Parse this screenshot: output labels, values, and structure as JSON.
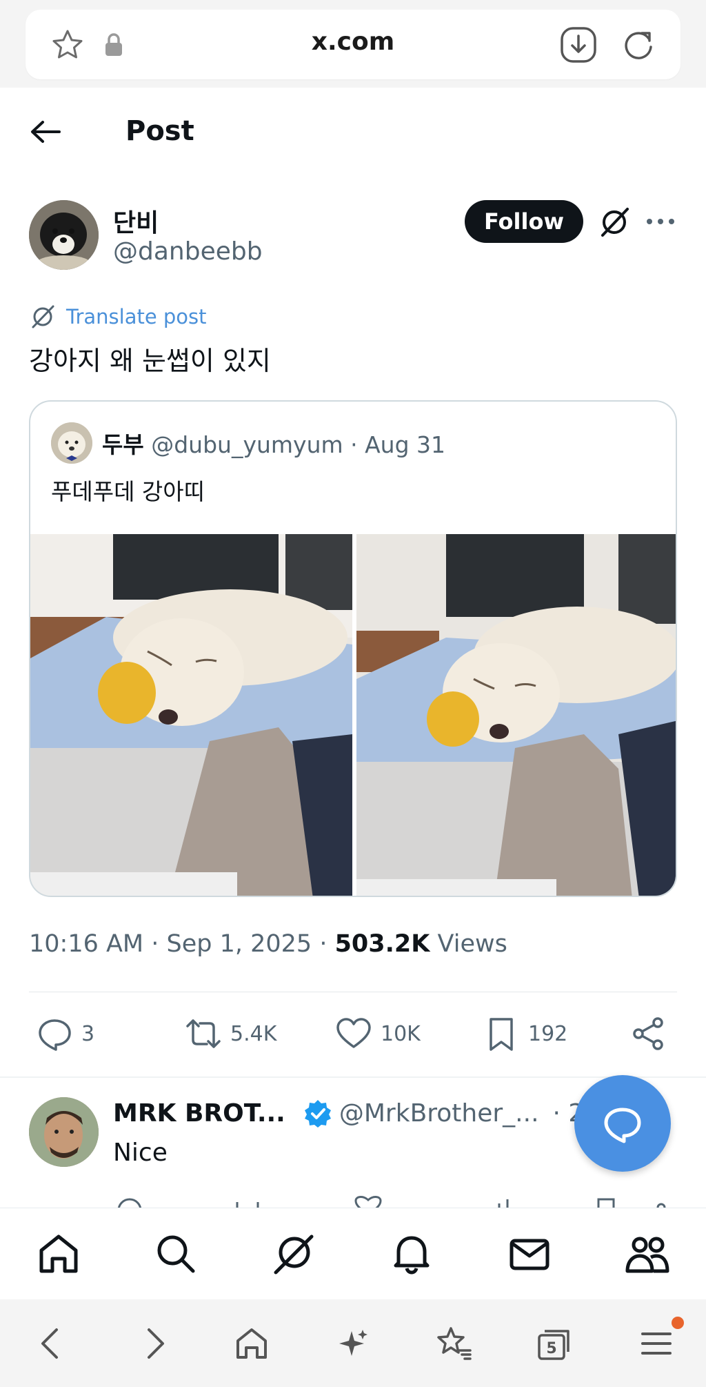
{
  "browser": {
    "url": "x.com",
    "tab_count": "5"
  },
  "header": {
    "title": "Post"
  },
  "post": {
    "author_name": "단비",
    "author_handle": "@danbeebb",
    "follow_label": "Follow",
    "translate_label": "Translate post",
    "text": "강아지 왜 눈썹이 있지",
    "timestamp": "10:16 AM · Sep 1, 2025 · ",
    "views_count": "503.2K",
    "views_label": " Views",
    "stats": {
      "replies": "3",
      "reposts": "5.4K",
      "likes": "10K",
      "bookmarks": "192"
    }
  },
  "quote": {
    "author_name": "두부",
    "author_handle": "@dubu_yumyum",
    "date": " · Aug 31",
    "text": "푸데푸데 강아띠"
  },
  "reply": {
    "author_name": "MRK BROT...",
    "author_handle": "@MrkBrother_...",
    "time": "· 23h",
    "text": "Nice"
  },
  "colors": {
    "accent": "#4a90e2",
    "text_primary": "#0f1419",
    "text_secondary": "#536471"
  }
}
